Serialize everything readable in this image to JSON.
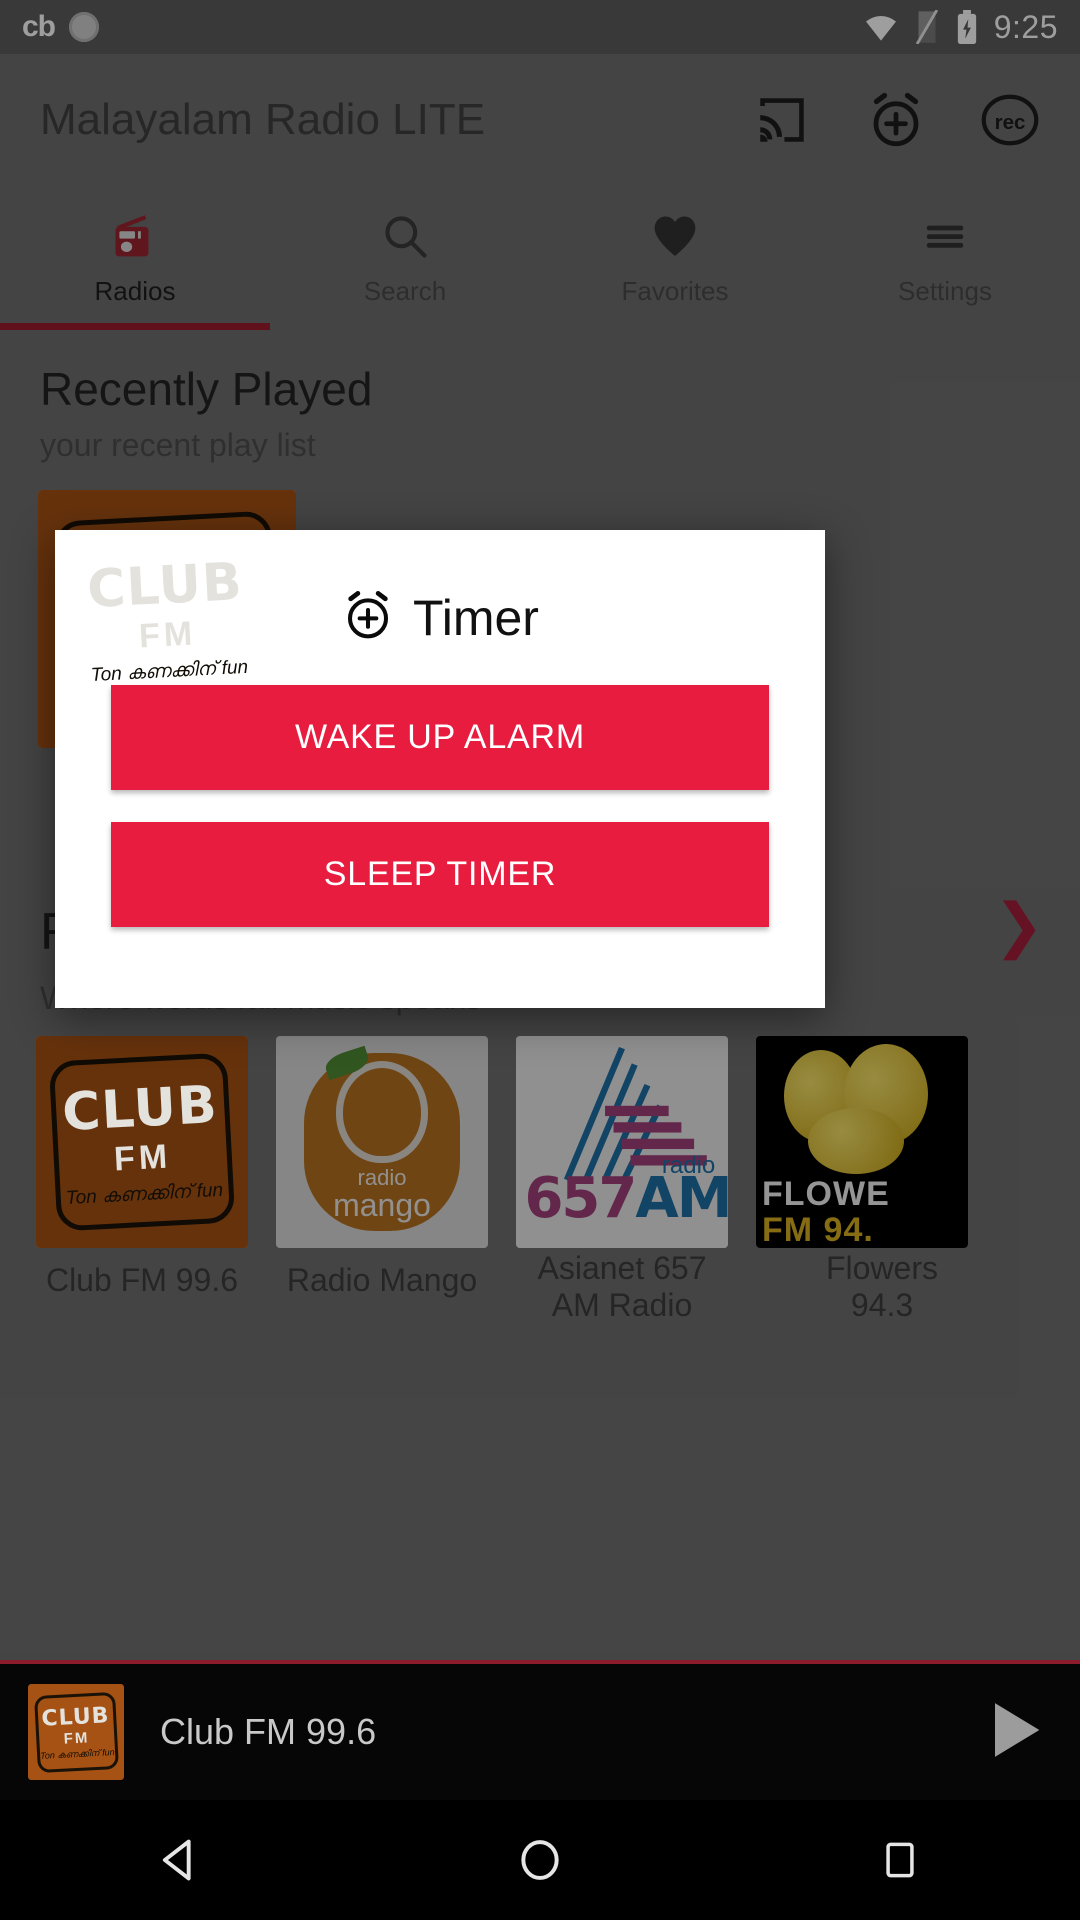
{
  "status_bar": {
    "app_badge": "cb",
    "icons": [
      "notification-dot-icon",
      "wifi-icon",
      "sim-card-icon",
      "battery-charging-icon"
    ],
    "time": "9:25"
  },
  "app_bar": {
    "title": "Malayalam Radio LITE",
    "actions": [
      {
        "name": "cast-icon",
        "label": "Cast"
      },
      {
        "name": "alarm-add-icon",
        "label": "Timer"
      },
      {
        "name": "record-icon",
        "label": "rec"
      }
    ]
  },
  "tabs": {
    "active_index": 0,
    "items": [
      {
        "label": "Radios",
        "icon": "radio-icon"
      },
      {
        "label": "Search",
        "icon": "search-icon"
      },
      {
        "label": "Favorites",
        "icon": "heart-icon"
      },
      {
        "label": "Settings",
        "icon": "hamburger-menu-icon"
      }
    ]
  },
  "content": {
    "recently_played": {
      "title": "Recently Played",
      "subtitle": "your recent play list"
    },
    "radios_section": {
      "title": "R",
      "subtitle": "Where words fail music speaks",
      "more_icon": "chevron-right-icon"
    },
    "stations": [
      {
        "name": "Club FM 99.6",
        "art": "club-fm",
        "art_text": {
          "l1": "CLUB",
          "l2": "FM",
          "l3": "Ton കണക്കിന് fun"
        }
      },
      {
        "name": "Radio Mango",
        "art": "radio-mango",
        "art_text": {
          "l1": "radio",
          "l2": "mango"
        }
      },
      {
        "name": "Asianet 657\nAM Radio",
        "art": "asianet-657",
        "art_text": {
          "l1": "657",
          "l2": "AM",
          "l3": "radio"
        }
      },
      {
        "name": "Flowers\n94.3",
        "art": "flowers-fm",
        "art_text": {
          "l1": "FLOWE",
          "l2": "FM 94."
        }
      }
    ]
  },
  "player": {
    "now_playing": "Club FM 99.6",
    "play_icon": "play-icon",
    "artwork": "club-fm"
  },
  "nav_bar": {
    "buttons": [
      {
        "name": "back-button",
        "icon": "triangle-back-icon"
      },
      {
        "name": "home-button",
        "icon": "circle-home-icon"
      },
      {
        "name": "recents-button",
        "icon": "square-recents-icon"
      }
    ]
  },
  "dialog": {
    "title": "Timer",
    "title_icon": "alarm-add-icon",
    "buttons": [
      {
        "label": "WAKE UP ALARM",
        "name": "wake-up-alarm-button"
      },
      {
        "label": "SLEEP TIMER",
        "name": "sleep-timer-button"
      }
    ]
  },
  "colors": {
    "accent_red": "#e81c3e",
    "tab_indicator": "#9b1c2e",
    "status_bar_bg": "#5c5c5c",
    "app_bg": "#6f6f6f",
    "player_bg": "#060606"
  }
}
